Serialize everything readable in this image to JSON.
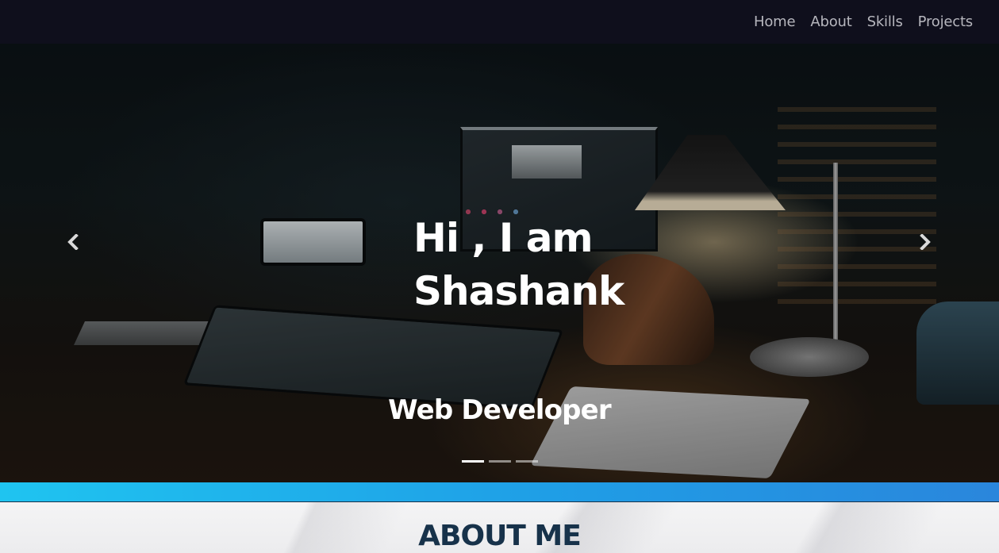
{
  "nav": {
    "links": [
      {
        "label": "Home"
      },
      {
        "label": "About"
      },
      {
        "label": "Skills"
      },
      {
        "label": "Projects"
      }
    ]
  },
  "hero": {
    "title": "Hi , I am Shashank",
    "subtitle": "Web Developer",
    "prev_icon": "chevron-left-icon",
    "next_icon": "chevron-right-icon",
    "slides": 3,
    "active_slide": 1
  },
  "about": {
    "title": "ABOUT ME"
  },
  "colors": {
    "navbar_bg": "#0f0f1c",
    "accent_start": "#1fc4f0",
    "accent_end": "#2a86dc",
    "about_title": "#17324a"
  }
}
